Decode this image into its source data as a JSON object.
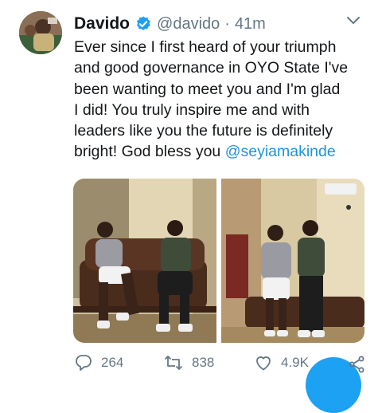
{
  "tweet": {
    "display_name": "Davido",
    "handle": "@davido",
    "separator": "·",
    "time": "41m",
    "text_lines": [
      "Ever since I first heard of your triumph",
      "and good governance in OYO State I've",
      "been wanting to meet you and I'm glad",
      "I did! You truly inspire me and with",
      "leaders like you the future is definitely"
    ],
    "last_line_text": "bright! God bless you ",
    "mention": "@seyiamakinde",
    "replies": "264",
    "retweets": "838",
    "likes": "4.9K"
  },
  "colors": {
    "accent": "#1da1f2",
    "mention": "#1b95e0",
    "secondary": "#657786",
    "text": "#14171a"
  },
  "icons": [
    "verified-badge-icon",
    "chevron-down-icon",
    "reply-icon",
    "retweet-icon",
    "like-icon",
    "share-icon"
  ]
}
